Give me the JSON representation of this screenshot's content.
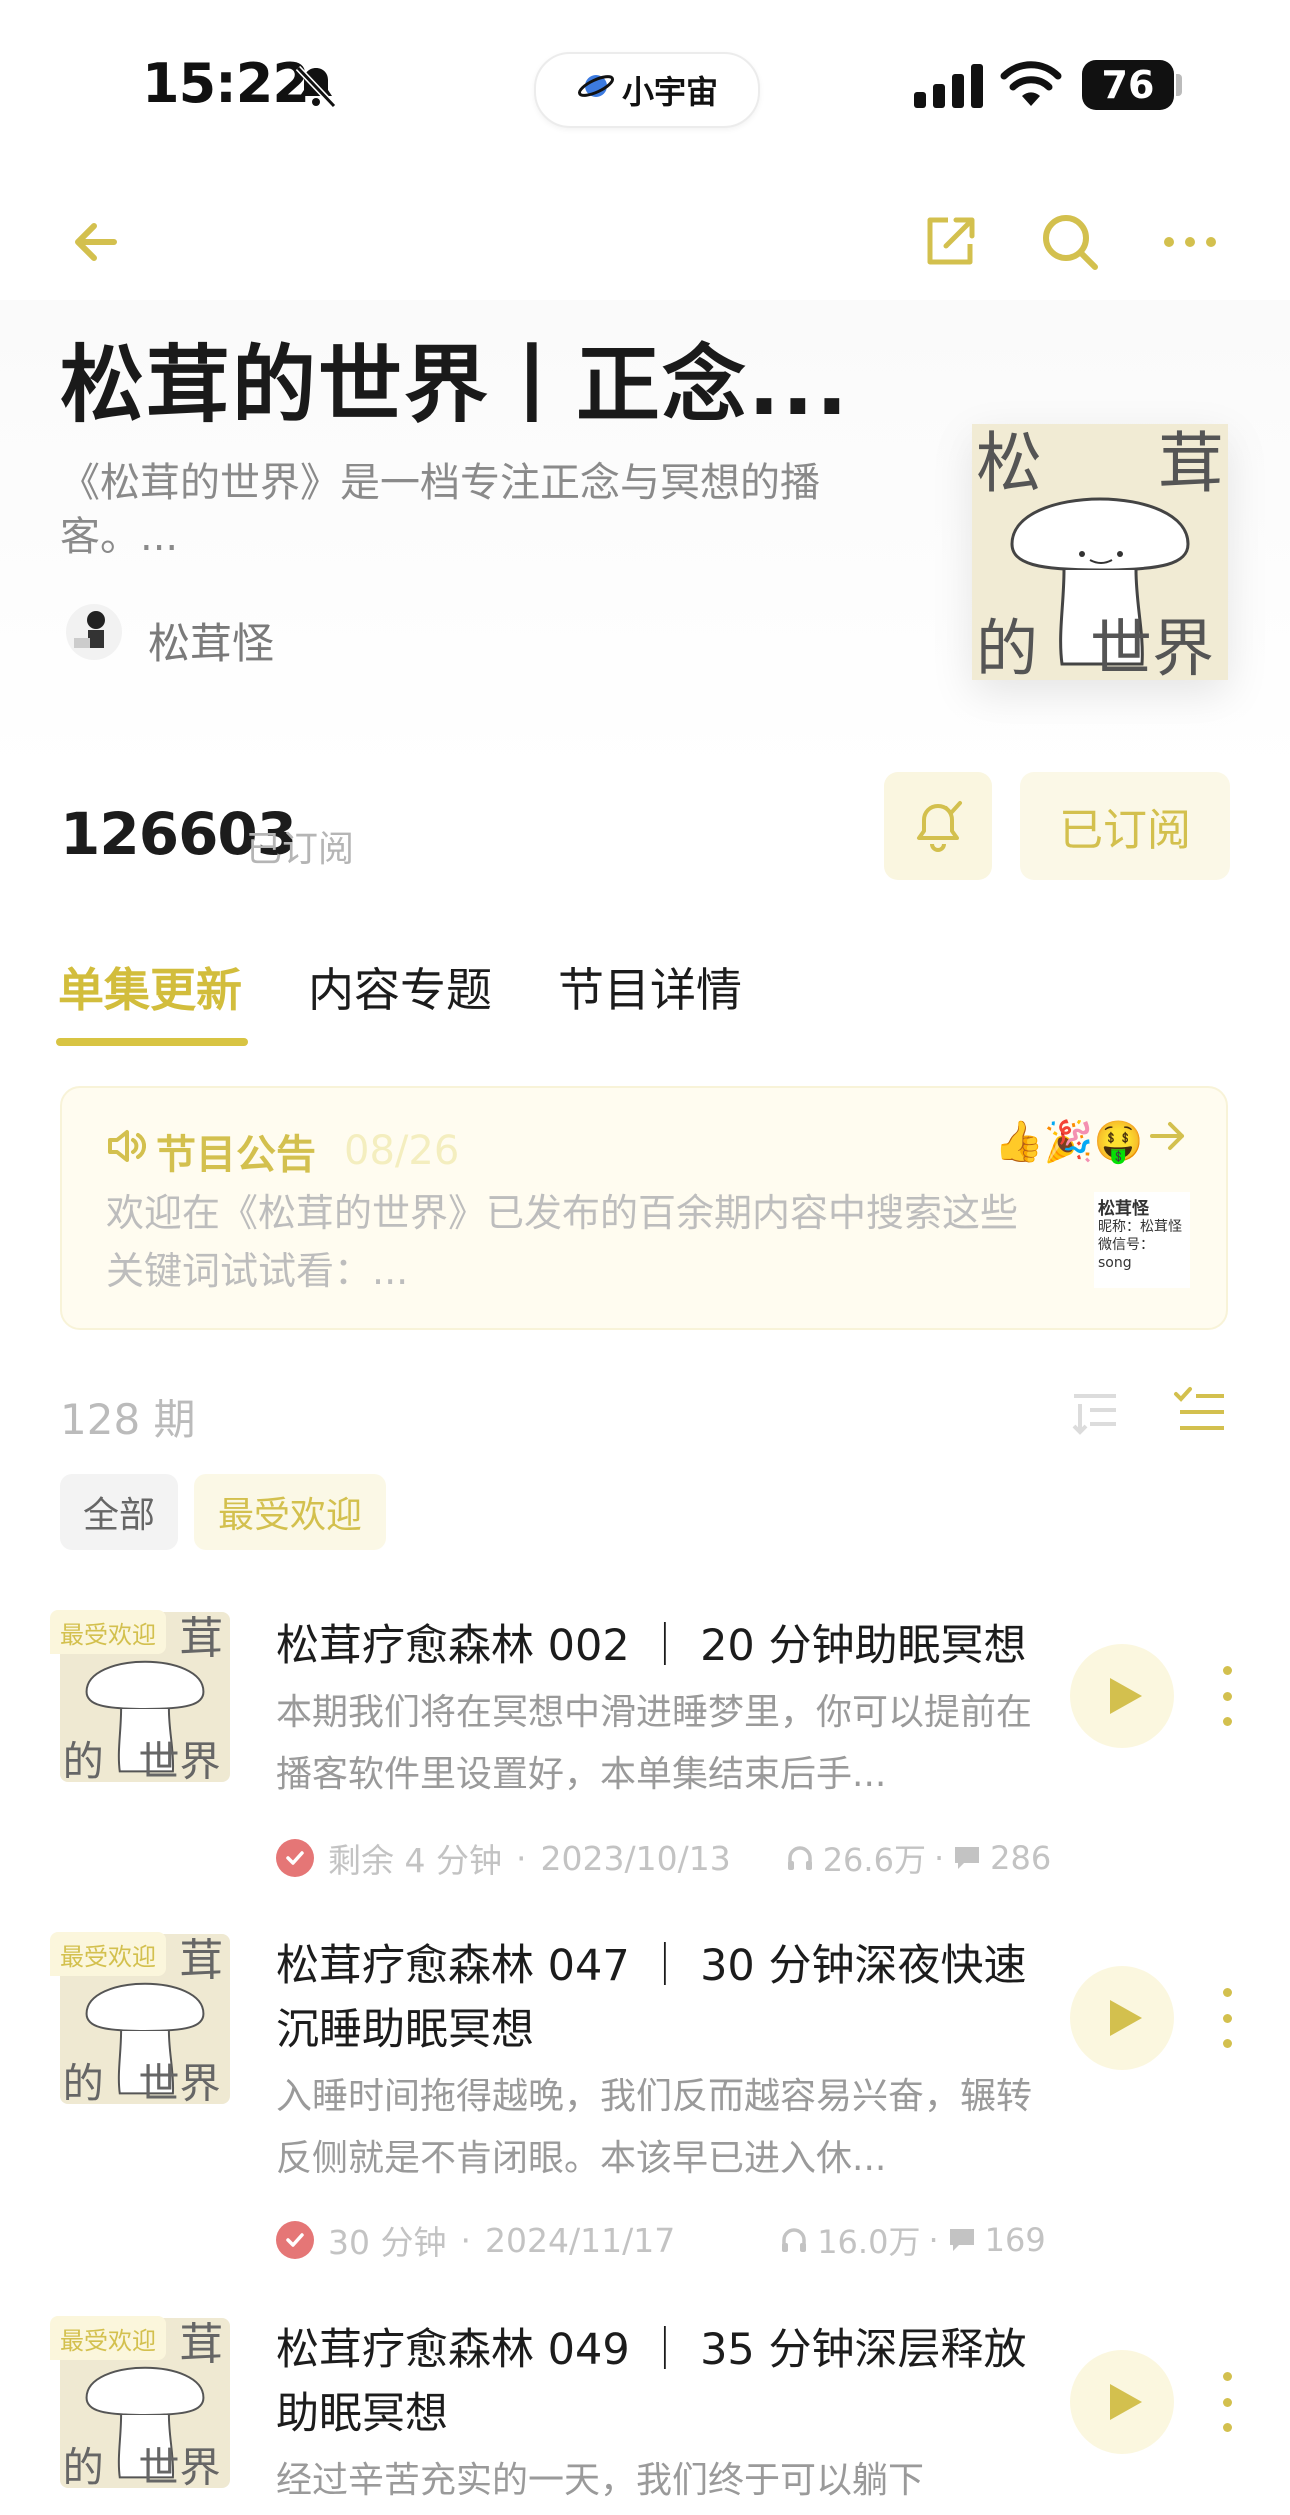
{
  "status_bar": {
    "time": "15:22",
    "app_pill": "小宇宙",
    "battery": "76"
  },
  "podcast": {
    "title": "松茸的世界丨正念...",
    "description": "《松茸的世界》是一档专注正念与冥想的播客。...",
    "author": "松茸怪",
    "cover_text": [
      "松",
      "茸",
      "的",
      "世界"
    ],
    "subscribers": "126603",
    "subscribers_label": "已订阅",
    "subscribe_button": "已订阅"
  },
  "tabs": [
    {
      "label": "单集更新",
      "active": true
    },
    {
      "label": "内容专题",
      "active": false
    },
    {
      "label": "节目详情",
      "active": false
    }
  ],
  "notice": {
    "title": "节目公告",
    "date": "08/26",
    "body": "欢迎在《松茸的世界》已发布的百余期内容中搜索这些关键词试试看：...",
    "emojis": "👍🎉🤑",
    "thumb_lines": [
      "松茸怪",
      "昵称：松茸怪",
      "微信号：song"
    ]
  },
  "list": {
    "count": "128 期",
    "filters": [
      {
        "label": "全部",
        "active": false
      },
      {
        "label": "最受欢迎",
        "active": true
      }
    ]
  },
  "episodes": [
    {
      "badge": "最受欢迎",
      "title": "松茸疗愈森林 002 ｜ 20 分钟助眠冥想",
      "desc": "本期我们将在冥想中滑进睡梦里，你可以提前在播客软件里设置好，本单集结束后手...",
      "duration": "剩余 4 分钟",
      "date": "2023/10/13",
      "plays": "26.6万",
      "comments": "286"
    },
    {
      "badge": "最受欢迎",
      "title": "松茸疗愈森林 047 ｜ 30 分钟深夜快速沉睡助眠冥想",
      "desc": "入睡时间拖得越晚，我们反而越容易兴奋，辗转反侧就是不肯闭眼。本该早已进入休...",
      "duration": "30 分钟",
      "date": "2024/11/17",
      "plays": "16.0万",
      "comments": "169"
    },
    {
      "badge": "最受欢迎",
      "title": "松茸疗愈森林 049 ｜ 35 分钟深层释放助眠冥想",
      "desc": "经过辛苦充实的一天，我们终于可以躺下"
    }
  ],
  "colors": {
    "accent": "#d3c04e",
    "accent_bg": "#fbf7df",
    "check": "#e57676"
  }
}
